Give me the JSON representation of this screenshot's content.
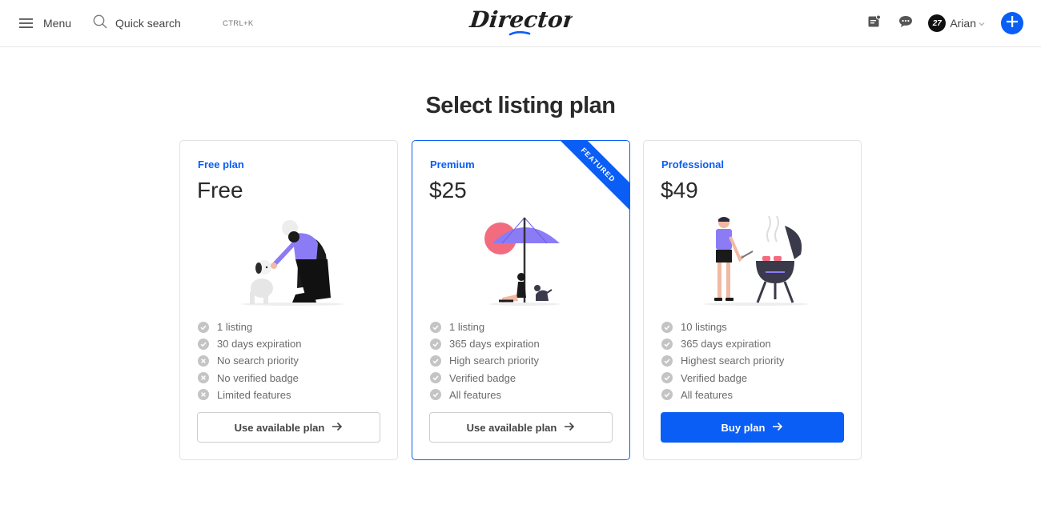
{
  "header": {
    "menu_label": "Menu",
    "search_label": "Quick search",
    "search_shortcut": "CTRL+K",
    "logo_text": "Directory",
    "user": {
      "avatar_text": "27",
      "name": "Arian"
    },
    "icons": [
      "menu-icon",
      "search-icon",
      "notes-icon",
      "chat-icon",
      "chevron-down-icon",
      "plus-icon"
    ]
  },
  "page": {
    "title": "Select listing plan"
  },
  "colors": {
    "accent": "#0a5ef5",
    "check": "#b8b8b8",
    "text": "#2a2a2a"
  },
  "plans": [
    {
      "name": "Free plan",
      "price": "Free",
      "features": [
        {
          "text": "1 listing",
          "icon": "check-icon"
        },
        {
          "text": "30 days expiration",
          "icon": "check-icon"
        },
        {
          "text": "No search priority",
          "icon": "x-icon"
        },
        {
          "text": "No verified badge",
          "icon": "x-icon"
        },
        {
          "text": "Limited features",
          "icon": "x-icon"
        }
      ],
      "button_label": "Use available plan"
    },
    {
      "name": "Premium",
      "price": "$25",
      "badge": "FEATURED",
      "features": [
        {
          "text": "1 listing",
          "icon": "check-icon"
        },
        {
          "text": "365 days expiration",
          "icon": "check-icon"
        },
        {
          "text": "High search priority",
          "icon": "check-icon"
        },
        {
          "text": "Verified badge",
          "icon": "check-icon"
        },
        {
          "text": "All features",
          "icon": "check-icon"
        }
      ],
      "button_label": "Use available plan"
    },
    {
      "name": "Professional",
      "price": "$49",
      "features": [
        {
          "text": "10 listings",
          "icon": "check-icon"
        },
        {
          "text": "365 days expiration",
          "icon": "check-icon"
        },
        {
          "text": "Highest search priority",
          "icon": "check-icon"
        },
        {
          "text": "Verified badge",
          "icon": "check-icon"
        },
        {
          "text": "All features",
          "icon": "check-icon"
        }
      ],
      "button_label": "Buy plan"
    }
  ]
}
